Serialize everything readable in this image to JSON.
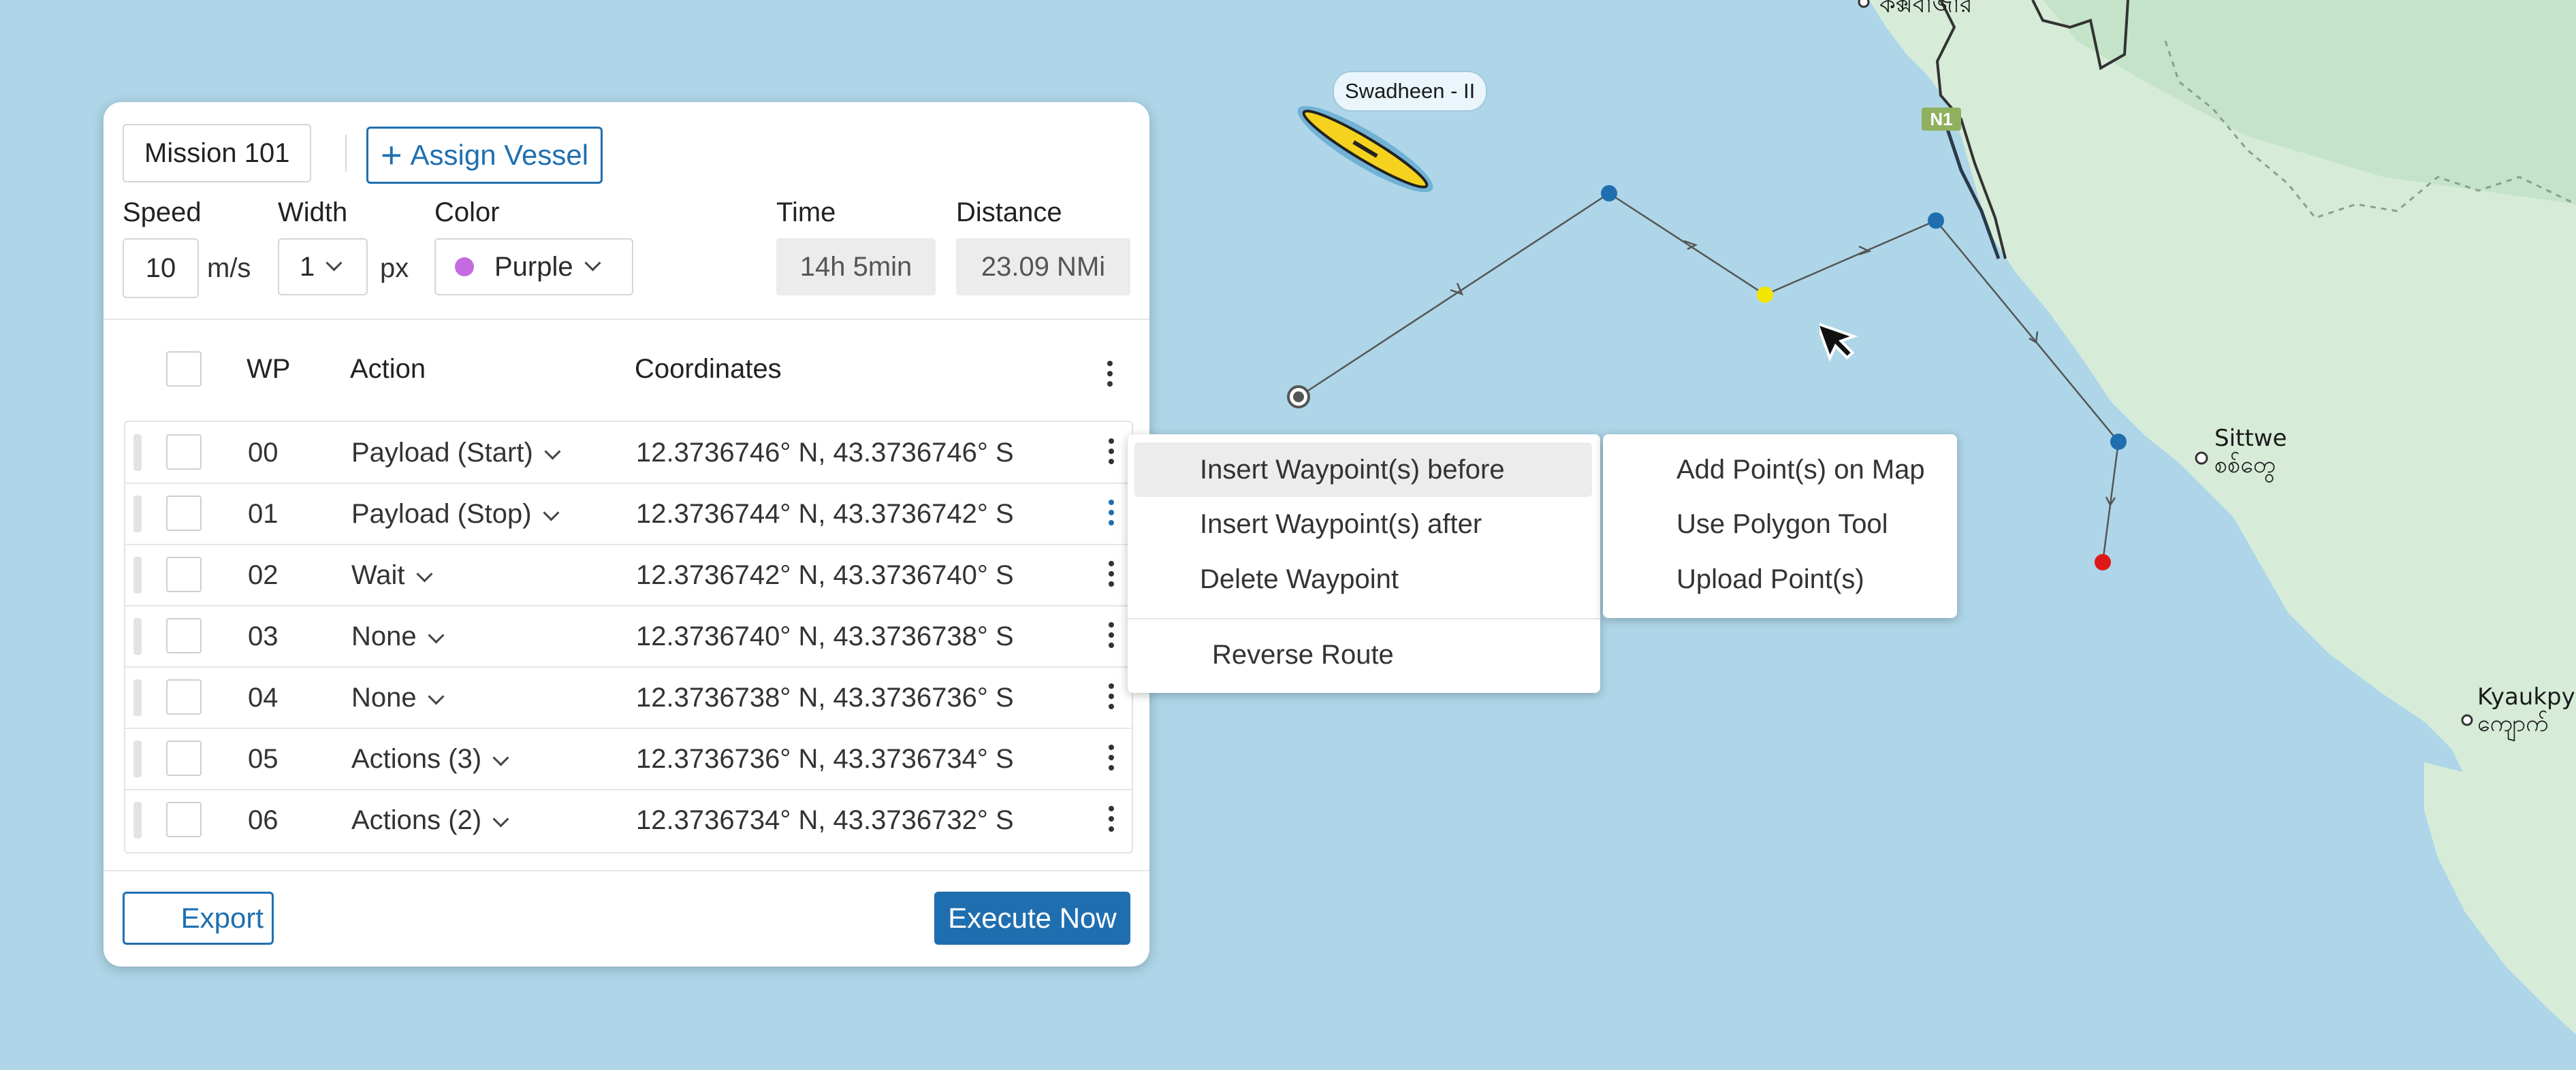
{
  "map": {
    "places": [
      {
        "name": "Sittwe",
        "native": "စစ်တွေ"
      },
      {
        "name": "Kyaukpy",
        "native": "ကျောက်"
      },
      {
        "name": "",
        "native": "কক্সবাজার"
      }
    ],
    "road_badge": "N1",
    "vessel_name": "Swadheen - II",
    "colors": {
      "water": "#aed6e8",
      "land": "#d6ecd9",
      "route": "#555555",
      "waypoint": "#1f6fb0",
      "current": "#f2e600",
      "end": "#e01818"
    }
  },
  "panel": {
    "mission_name": "Mission 101",
    "assign_vessel_label": "Assign Vessel",
    "assign_icon": "plus-icon",
    "speed": {
      "label": "Speed",
      "value": "10",
      "unit": "m/s"
    },
    "width": {
      "label": "Width",
      "value": "1",
      "unit": "px"
    },
    "color": {
      "label": "Color",
      "value": "Purple",
      "swatch": "#c56ae0"
    },
    "time": {
      "label": "Time",
      "value": "14h 5min"
    },
    "distance": {
      "label": "Distance",
      "value": "23.09 NMi"
    },
    "table": {
      "headers": {
        "wp": "WP",
        "action": "Action",
        "coordinates": "Coordinates"
      },
      "rows": [
        {
          "wp": "00",
          "action": "Payload (Start)",
          "coords": "12.3736746° N, 43.3736746° S"
        },
        {
          "wp": "01",
          "action": "Payload (Stop)",
          "coords": "12.3736744° N, 43.3736742° S"
        },
        {
          "wp": "02",
          "action": "Wait",
          "coords": "12.3736742° N, 43.3736740° S"
        },
        {
          "wp": "03",
          "action": "None",
          "coords": "12.3736740° N, 43.3736738° S"
        },
        {
          "wp": "04",
          "action": "None",
          "coords": "12.3736738° N, 43.3736736° S"
        },
        {
          "wp": "05",
          "action": "Actions (3)",
          "coords": "12.3736736° N, 43.3736734° S"
        },
        {
          "wp": "06",
          "action": "Actions (2)",
          "coords": "12.3736734° N, 43.3736732° S"
        }
      ]
    },
    "export_label": "Export",
    "execute_label": "Execute Now"
  },
  "context_menu": {
    "items": [
      "Insert Waypoint(s) before",
      "Insert Waypoint(s) after",
      "Delete Waypoint",
      "Reverse Route"
    ],
    "highlighted": "Insert Waypoint(s) before"
  },
  "submenu": {
    "items": [
      "Add Point(s) on Map",
      "Use Polygon Tool",
      "Upload Point(s)"
    ]
  }
}
